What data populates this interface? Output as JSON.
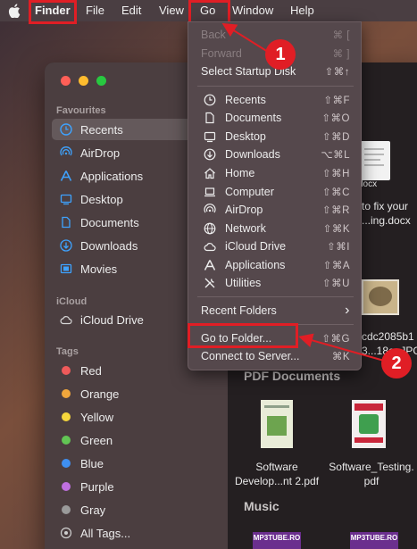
{
  "menubar": {
    "apple_icon": "apple-icon",
    "items": [
      "Finder",
      "File",
      "Edit",
      "View",
      "Go",
      "Window",
      "Help"
    ]
  },
  "go_menu": {
    "back": {
      "label": "Back",
      "shortcut": "⌘ ["
    },
    "forward": {
      "label": "Forward",
      "shortcut": "⌘ ]"
    },
    "startup_disk": {
      "label": "Select Startup Disk",
      "shortcut": "⇧⌘↑"
    },
    "places": [
      {
        "label": "Recents",
        "shortcut": "⇧⌘F",
        "icon": "clock-icon"
      },
      {
        "label": "Documents",
        "shortcut": "⇧⌘O",
        "icon": "document-icon"
      },
      {
        "label": "Desktop",
        "shortcut": "⇧⌘D",
        "icon": "desktop-icon"
      },
      {
        "label": "Downloads",
        "shortcut": "⌥⌘L",
        "icon": "download-icon"
      },
      {
        "label": "Home",
        "shortcut": "⇧⌘H",
        "icon": "home-icon"
      },
      {
        "label": "Computer",
        "shortcut": "⇧⌘C",
        "icon": "laptop-icon"
      },
      {
        "label": "AirDrop",
        "shortcut": "⇧⌘R",
        "icon": "airdrop-icon"
      },
      {
        "label": "Network",
        "shortcut": "⇧⌘K",
        "icon": "globe-icon"
      },
      {
        "label": "iCloud Drive",
        "shortcut": "⇧⌘I",
        "icon": "cloud-icon"
      },
      {
        "label": "Applications",
        "shortcut": "⇧⌘A",
        "icon": "applications-icon"
      },
      {
        "label": "Utilities",
        "shortcut": "⇧⌘U",
        "icon": "utilities-icon"
      }
    ],
    "recent_folders": {
      "label": "Recent Folders",
      "chevron": "›"
    },
    "go_to_folder": {
      "label": "Go to Folder...",
      "shortcut": "⇧⌘G"
    },
    "connect_server": {
      "label": "Connect to Server...",
      "shortcut": "⌘K"
    }
  },
  "sidebar": {
    "favourites_label": "Favourites",
    "favourites": [
      {
        "label": "Recents",
        "icon": "clock-icon"
      },
      {
        "label": "AirDrop",
        "icon": "airdrop-icon"
      },
      {
        "label": "Applications",
        "icon": "applications-icon"
      },
      {
        "label": "Desktop",
        "icon": "desktop-icon"
      },
      {
        "label": "Documents",
        "icon": "document-icon"
      },
      {
        "label": "Downloads",
        "icon": "download-icon"
      },
      {
        "label": "Movies",
        "icon": "film-icon"
      }
    ],
    "icloud_label": "iCloud",
    "icloud_items": [
      {
        "label": "iCloud Drive",
        "icon": "cloud-icon"
      }
    ],
    "tags_label": "Tags",
    "tags": [
      {
        "label": "Red",
        "color": "#ef5a5a"
      },
      {
        "label": "Orange",
        "color": "#f0a63c"
      },
      {
        "label": "Yellow",
        "color": "#f5d63c"
      },
      {
        "label": "Green",
        "color": "#62c554"
      },
      {
        "label": "Blue",
        "color": "#3f8ff0"
      },
      {
        "label": "Purple",
        "color": "#c070e0"
      },
      {
        "label": "Gray",
        "color": "#9a9a9a"
      },
      {
        "label": "All Tags...",
        "color": ""
      }
    ]
  },
  "content": {
    "file1": {
      "line1": "docx",
      "line2": "to fix your",
      "line3": "...ing.docx"
    },
    "file2": {
      "line1": "cdc2085b1",
      "line2": "3...18e..JPG"
    },
    "pdf_section": "PDF Documents",
    "pdf1": {
      "line1": "Software",
      "line2": "Develop...nt 2.pdf"
    },
    "pdf2": {
      "line1": "Software_Testing.",
      "line2": "pdf"
    },
    "music_section": "Music",
    "music_thumb": "MP3TUBE.RO"
  },
  "annotations": {
    "badge1": "1",
    "badge2": "2"
  },
  "colors": {
    "annotation_red": "#e01e25",
    "accent_blue": "#3ea3ff"
  }
}
